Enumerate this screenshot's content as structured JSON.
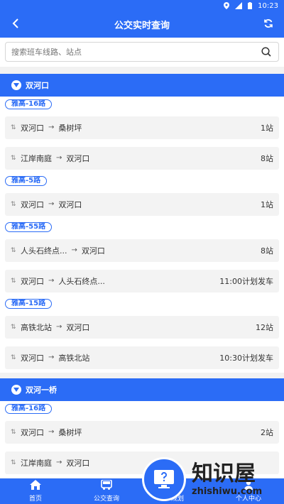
{
  "status_bar": {
    "time": "10:23"
  },
  "header": {
    "title": "公交实时查询"
  },
  "search": {
    "placeholder": "搜索班车线路、站点"
  },
  "groups": [
    {
      "station": "双河口",
      "routes": [
        {
          "name": "雅高-16路",
          "trips": [
            {
              "from": "双河口",
              "to": "桑树坪",
              "status": "1站"
            },
            {
              "from": "江岸南庭",
              "to": "双河口",
              "status": "8站"
            }
          ]
        },
        {
          "name": "雅高-5路",
          "trips": [
            {
              "from": "双河口",
              "to": "双河口",
              "status": "1站"
            }
          ]
        },
        {
          "name": "雅高-55路",
          "trips": [
            {
              "from": "人头石终点...",
              "to": "双河口",
              "status": "8站"
            },
            {
              "from": "双河口",
              "to": "人头石终点...",
              "status": "11:00计划发车"
            }
          ]
        },
        {
          "name": "雅高-15路",
          "trips": [
            {
              "from": "高铁北站",
              "to": "双河口",
              "status": "12站"
            },
            {
              "from": "双河口",
              "to": "高铁北站",
              "status": "10:30计划发车"
            }
          ]
        }
      ]
    },
    {
      "station": "双河一桥",
      "routes": [
        {
          "name": "雅高-16路",
          "trips": [
            {
              "from": "双河口",
              "to": "桑树坪",
              "status": "2站"
            },
            {
              "from": "江岸南庭",
              "to": "双河口",
              "status": ""
            }
          ]
        }
      ]
    }
  ],
  "tabbar": {
    "items": [
      {
        "label": "首页",
        "icon": "home-icon"
      },
      {
        "label": "公交查询",
        "icon": "bus-icon"
      },
      {
        "label": "规划",
        "icon": "route-icon"
      },
      {
        "label": "个人中心",
        "icon": "user-icon"
      }
    ]
  },
  "watermark": {
    "big": "知识屋",
    "small": "zhishiwu.com"
  },
  "colors": {
    "primary": "#2b6cf6",
    "background": "#f2f2f2"
  }
}
